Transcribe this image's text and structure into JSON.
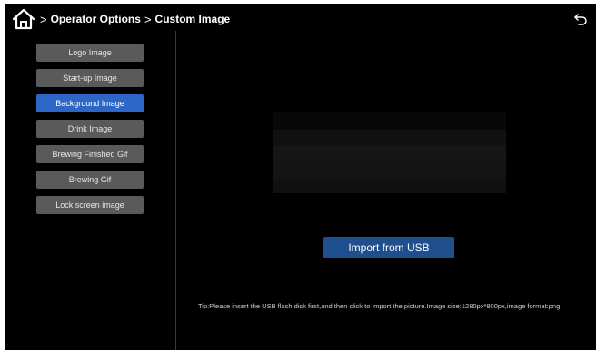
{
  "header": {
    "breadcrumb": [
      "Operator Options",
      "Custom Image"
    ],
    "home_icon": "home-icon",
    "back_icon": "return-arrow-icon"
  },
  "sidebar": {
    "items": [
      {
        "label": "Logo Image",
        "active": false
      },
      {
        "label": "Start-up Image",
        "active": false
      },
      {
        "label": "Background Image",
        "active": true
      },
      {
        "label": "Drink Image",
        "active": false
      },
      {
        "label": "Brewing Finished Gif",
        "active": false
      },
      {
        "label": "Brewing Gif",
        "active": false
      },
      {
        "label": "Lock screen image",
        "active": false
      }
    ]
  },
  "main": {
    "import_label": "Import from USB",
    "tip": "Tip:Please insert the USB flash disk first,and then click to import the picture.Image size:1280px*800px,image format:png"
  },
  "colors": {
    "active": "#2c67c7",
    "button": "#5a5a5a",
    "import": "#1f4f8e",
    "background": "#000000"
  }
}
